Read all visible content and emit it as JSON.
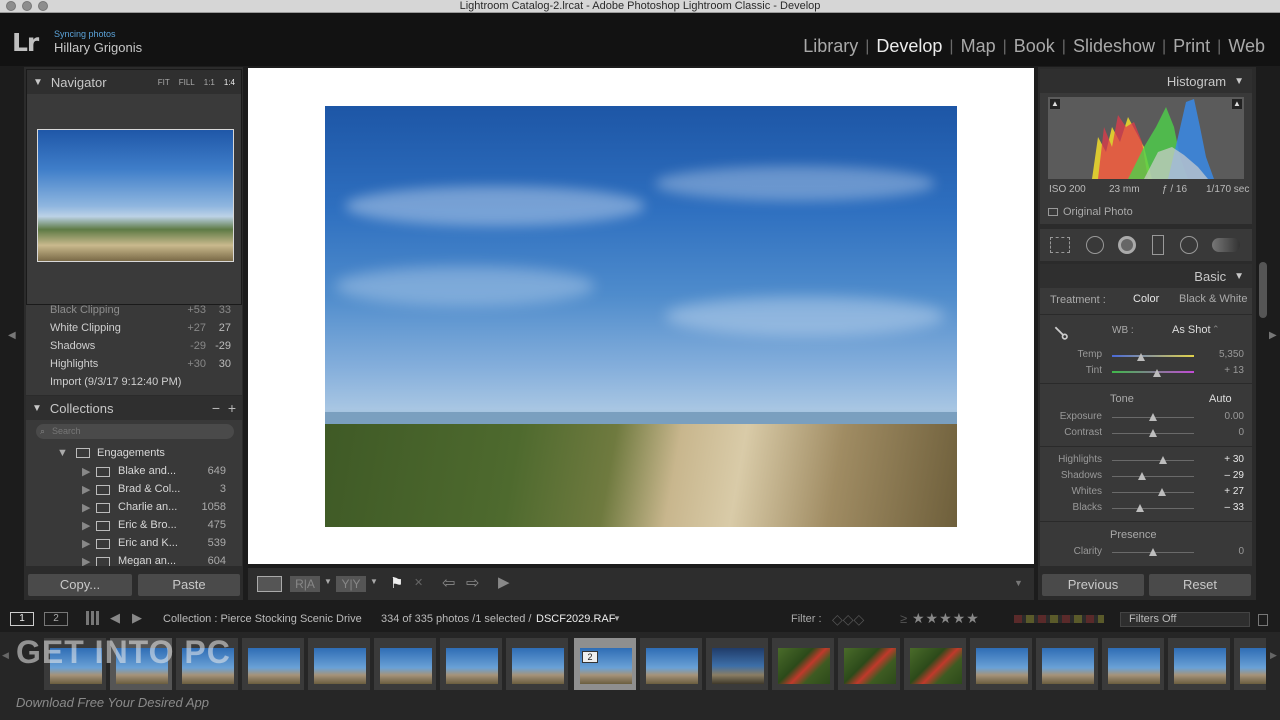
{
  "window_title": "Lightroom Catalog-2.lrcat - Adobe Photoshop Lightroom Classic - Develop",
  "identity": {
    "logo": "Lr",
    "status": "Syncing photos",
    "user": "Hillary Grigonis"
  },
  "modules": [
    "Library",
    "Develop",
    "Map",
    "Book",
    "Slideshow",
    "Print",
    "Web"
  ],
  "active_module": "Develop",
  "navigator": {
    "title": "Navigator",
    "zoom_options": [
      "FIT",
      "FILL",
      "1:1",
      "1:4"
    ]
  },
  "history": [
    {
      "label": "Black Clipping",
      "delta": "+53",
      "value": "33"
    },
    {
      "label": "White Clipping",
      "delta": "+27",
      "value": "27"
    },
    {
      "label": "Shadows",
      "delta": "-29",
      "value": "-29"
    },
    {
      "label": "Highlights",
      "delta": "+30",
      "value": "30"
    },
    {
      "label": "Import (9/3/17 9:12:40 PM)",
      "delta": "",
      "value": ""
    }
  ],
  "collections": {
    "title": "Collections",
    "search_placeholder": "Search",
    "group": "Engagements",
    "items": [
      {
        "name": "Blake and...",
        "count": "649"
      },
      {
        "name": "Brad & Col...",
        "count": "3"
      },
      {
        "name": "Charlie an...",
        "count": "1058"
      },
      {
        "name": "Eric & Bro...",
        "count": "475"
      },
      {
        "name": "Eric and K...",
        "count": "539"
      },
      {
        "name": "Megan an...",
        "count": "604"
      }
    ]
  },
  "left_buttons": {
    "copy": "Copy...",
    "paste": "Paste"
  },
  "toolbar": {
    "compare_left": "R|A",
    "compare_right": "Y|Y"
  },
  "histogram": {
    "title": "Histogram",
    "iso": "ISO 200",
    "focal": "23 mm",
    "aperture": "ƒ / 16",
    "shutter": "1/170 sec",
    "original_photo": "Original Photo"
  },
  "basic": {
    "title": "Basic",
    "treatment_label": "Treatment :",
    "treatment_color": "Color",
    "treatment_bw": "Black & White",
    "wb_label": "WB :",
    "wb_value": "As Shot",
    "temp": {
      "label": "Temp",
      "value": "5,350",
      "pos": 0.35
    },
    "tint": {
      "label": "Tint",
      "value": "+ 13",
      "pos": 0.55
    },
    "tone_label": "Tone",
    "auto": "Auto",
    "exposure": {
      "label": "Exposure",
      "value": "0.00",
      "pos": 0.5
    },
    "contrast": {
      "label": "Contrast",
      "value": "0",
      "pos": 0.5
    },
    "highlights": {
      "label": "Highlights",
      "value": "+ 30",
      "pos": 0.62
    },
    "shadows": {
      "label": "Shadows",
      "value": "– 29",
      "pos": 0.36
    },
    "whites": {
      "label": "Whites",
      "value": "+ 27",
      "pos": 0.61
    },
    "blacks": {
      "label": "Blacks",
      "value": "– 33",
      "pos": 0.34
    },
    "presence_label": "Presence",
    "clarity": {
      "label": "Clarity",
      "value": "0",
      "pos": 0.5
    }
  },
  "right_buttons": {
    "previous": "Previous",
    "reset": "Reset"
  },
  "filmstrip": {
    "page1": "1",
    "page2": "2",
    "source": "Collection : Pierce Stocking Scenic Drive",
    "count": "334 of 335 photos /1 selected /",
    "filename": "DSCF2029.RAF",
    "filter_label": "Filter :",
    "filters_off": "Filters Off",
    "selected_badge": "2"
  },
  "watermark": {
    "main": "GET INTO PC",
    "sub": "Download Free Your Desired App"
  }
}
